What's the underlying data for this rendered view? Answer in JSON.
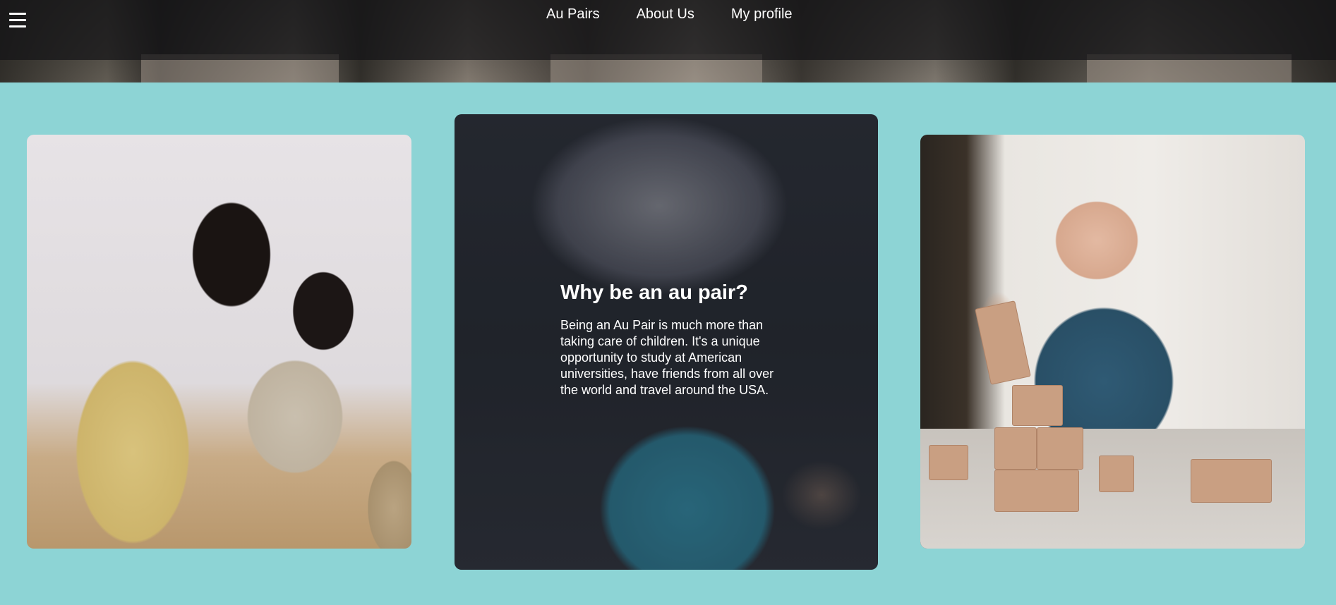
{
  "nav": {
    "menu_icon": "hamburger-menu-icon",
    "links": [
      {
        "label": "Au Pairs"
      },
      {
        "label": "About Us"
      },
      {
        "label": "My profile"
      }
    ]
  },
  "cards": {
    "left": {
      "image": "mother-and-daughter-playing-photo"
    },
    "center": {
      "image": "child-with-giant-bubble-photo",
      "title": "Why be an au pair?",
      "body": "Being an Au Pair is much more than taking care of children. It's a unique opportunity to study at American universities, have friends from all over the world and travel around the USA."
    },
    "right": {
      "image": "toddler-stacking-blocks-photo"
    }
  },
  "colors": {
    "background": "#8dd4d5",
    "nav_overlay": "#141416",
    "text": "#ffffff"
  }
}
